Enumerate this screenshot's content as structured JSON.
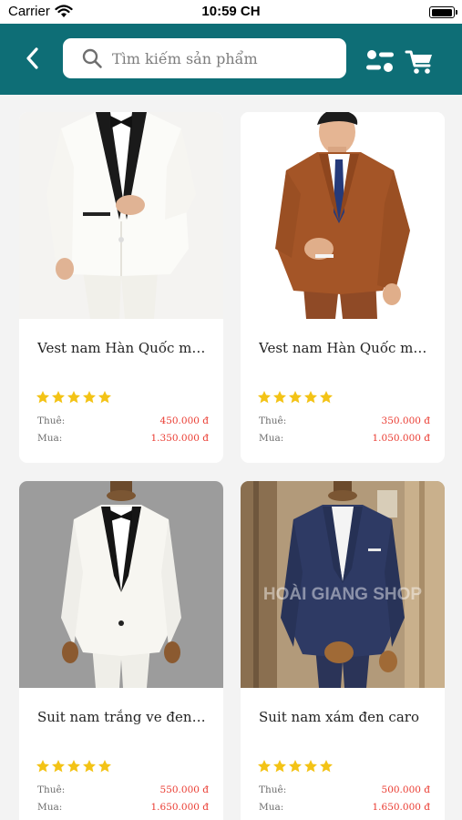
{
  "status_bar": {
    "carrier": "Carrier",
    "time": "10:59 CH",
    "battery_level": 1.0
  },
  "header": {
    "back_icon": "chevron-left-icon",
    "search_icon": "search-icon",
    "search_placeholder": "Tìm kiếm sản phẩm",
    "filter_icon": "filter-icon",
    "cart_icon": "cart-icon"
  },
  "colors": {
    "header_bg": "#0e6e76",
    "price": "#ea3a30",
    "star": "#f3c316"
  },
  "price_labels": {
    "rent": "Thuê:",
    "buy": "Mua:"
  },
  "products": [
    {
      "title": "Vest nam Hàn Quốc màu trắng",
      "rating": 5,
      "rent_price": "450.000 đ",
      "buy_price": "1.350.000 đ"
    },
    {
      "title": "Vest nam Hàn Quốc màu nâu",
      "rating": 5,
      "rent_price": "350.000 đ",
      "buy_price": "1.050.000 đ"
    },
    {
      "title": "Suit nam trắng ve đen nhung",
      "rating": 5,
      "rent_price": "550.000 đ",
      "buy_price": "1.650.000 đ"
    },
    {
      "title": "Suit nam xám đen caro",
      "rating": 5,
      "rent_price": "500.000 đ",
      "buy_price": "1.650.000 đ"
    }
  ],
  "watermark": "HOÀI GIANG SHOP"
}
